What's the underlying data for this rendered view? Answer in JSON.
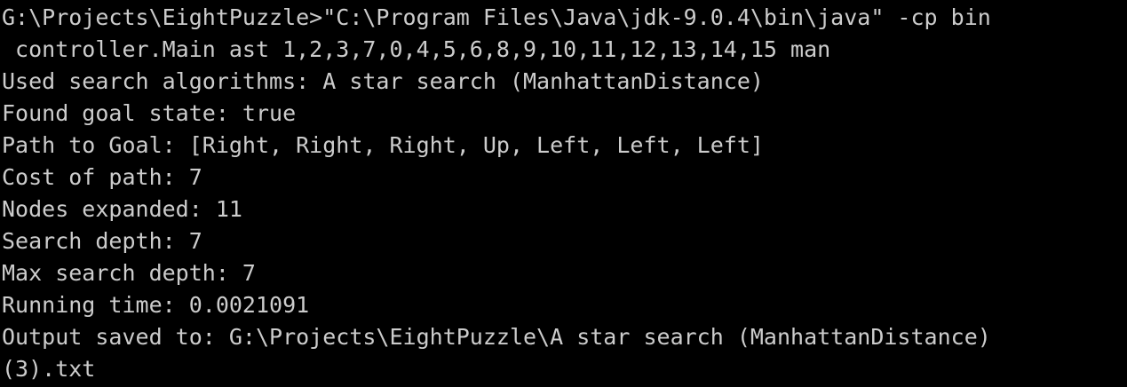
{
  "console": {
    "lines": [
      "G:\\Projects\\EightPuzzle>\"C:\\Program Files\\Java\\jdk-9.0.4\\bin\\java\" -cp bin",
      " controller.Main ast 1,2,3,7,0,4,5,6,8,9,10,11,12,13,14,15 man",
      "Used search algorithms: A star search (ManhattanDistance)",
      "Found goal state: true",
      "Path to Goal: [Right, Right, Right, Up, Left, Left, Left]",
      "Cost of path: 7",
      "Nodes expanded: 11",
      "Search depth: 7",
      "Max search depth: 7",
      "Running time: 0.0021091",
      "Output saved to: G:\\Projects\\EightPuzzle\\A star search (ManhattanDistance)",
      "(3).txt"
    ]
  },
  "colors": {
    "background": "#000000",
    "text": "#cccccc"
  }
}
